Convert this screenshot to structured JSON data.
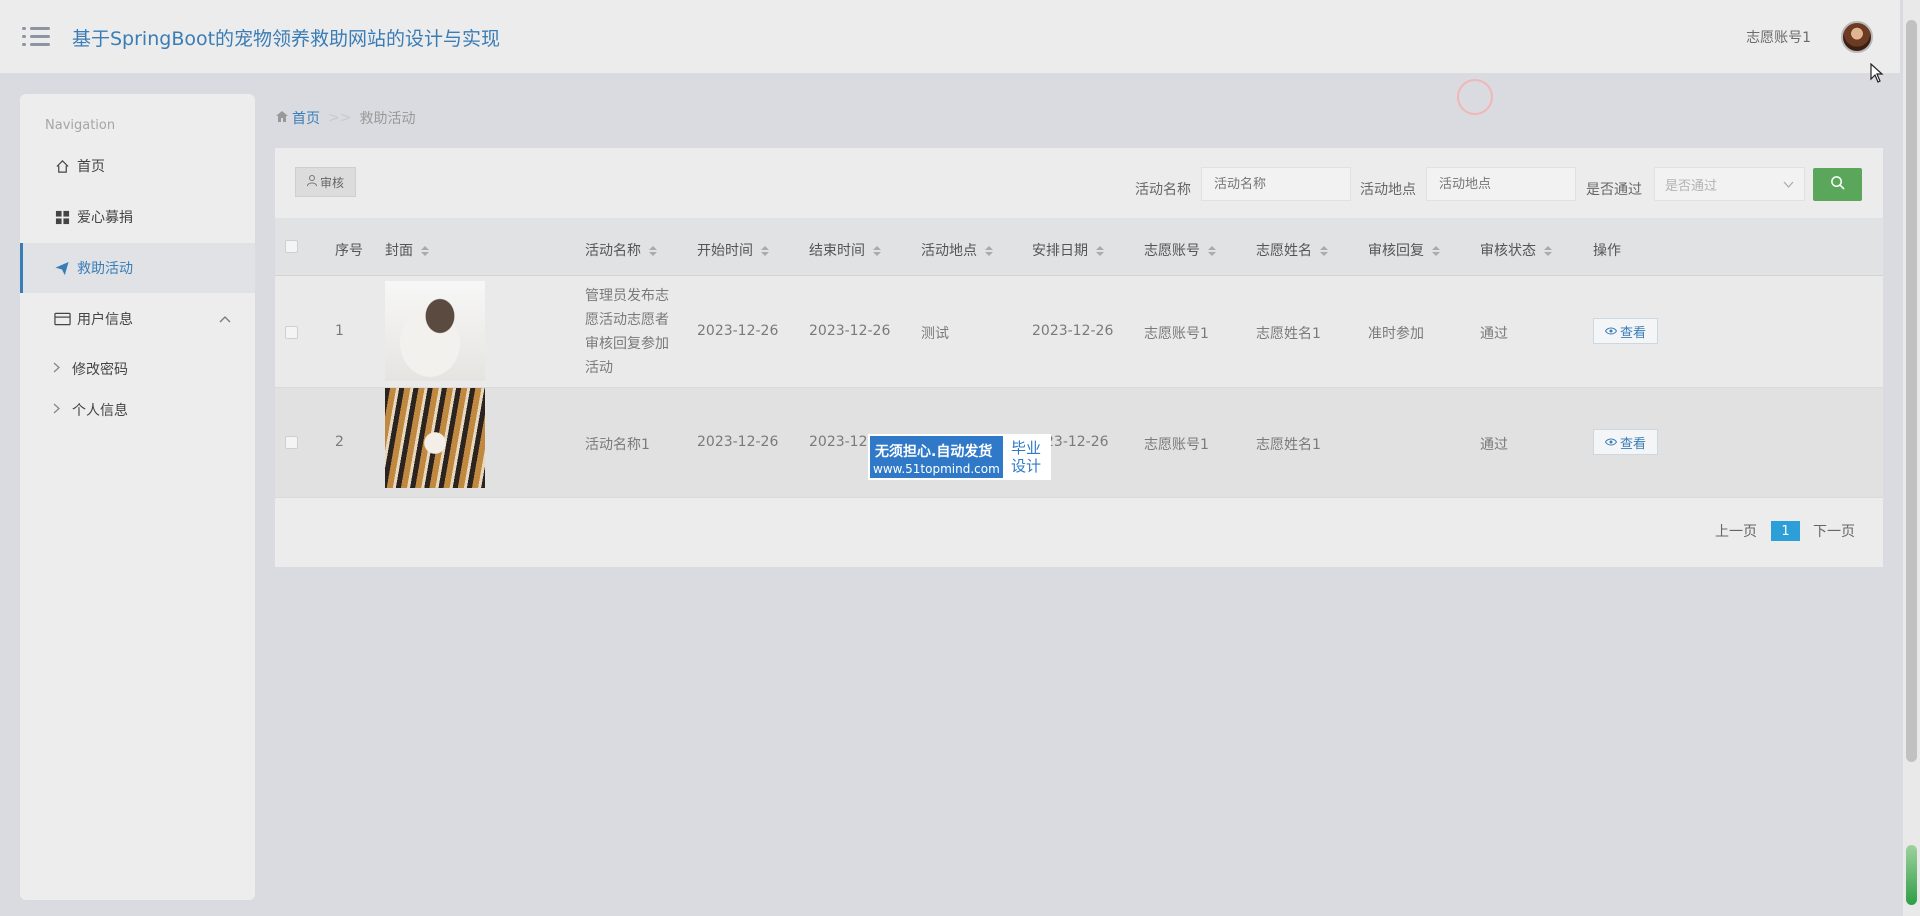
{
  "header": {
    "title": "基于SpringBoot的宠物领养救助网站的设计与实现",
    "username": "志愿账号1"
  },
  "sidebar": {
    "heading": "Navigation",
    "items": [
      {
        "label": "首页",
        "icon": "home-icon"
      },
      {
        "label": "爱心募捐",
        "icon": "grid-icon"
      },
      {
        "label": "救助活动",
        "icon": "paper-plane-icon",
        "active": true
      },
      {
        "label": "用户信息",
        "icon": "card-icon",
        "expanded": true
      }
    ],
    "subitems": [
      {
        "label": "修改密码"
      },
      {
        "label": "个人信息"
      }
    ]
  },
  "breadcrumb": {
    "home": "首页",
    "separator": ">>",
    "current": "救助活动"
  },
  "toolbar": {
    "audit_label": "审核",
    "filters": [
      {
        "label": "活动名称",
        "placeholder": "活动名称"
      },
      {
        "label": "活动地点",
        "placeholder": "活动地点"
      },
      {
        "label": "是否通过",
        "placeholder": "是否通过"
      }
    ]
  },
  "table": {
    "columns": [
      "序号",
      "封面",
      "活动名称",
      "开始时间",
      "结束时间",
      "活动地点",
      "安排日期",
      "志愿账号",
      "志愿姓名",
      "审核回复",
      "审核状态",
      "操作"
    ],
    "rows": [
      {
        "index": "1",
        "cover": "cat",
        "name": "管理员发布志愿活动志愿者审核回复参加活动",
        "start": "2023-12-26",
        "end": "2023-12-26",
        "location": "测试",
        "date": "2023-12-26",
        "account": "志愿账号1",
        "volunteer": "志愿姓名1",
        "reply": "准时参加",
        "status": "通过",
        "action": "查看"
      },
      {
        "index": "2",
        "cover": "tiger",
        "name": "活动名称1",
        "start": "2023-12-26",
        "end": "2023-12-",
        "location": "",
        "date": "23-12-26",
        "account": "志愿账号1",
        "volunteer": "志愿姓名1",
        "reply": "",
        "status": "通过",
        "action": "查看"
      }
    ]
  },
  "pagination": {
    "prev": "上一页",
    "page": "1",
    "next": "下一页"
  },
  "watermark": {
    "line1": "无须担心.自动发货",
    "line2": "www.51topmind.com",
    "badge_line1": "毕业",
    "badge_line2": "设计"
  },
  "colors": {
    "accent": "#3a7db6",
    "search_button": "#5aa75c",
    "page_active": "#2d9fd8",
    "watermark": "#2f79c8"
  }
}
